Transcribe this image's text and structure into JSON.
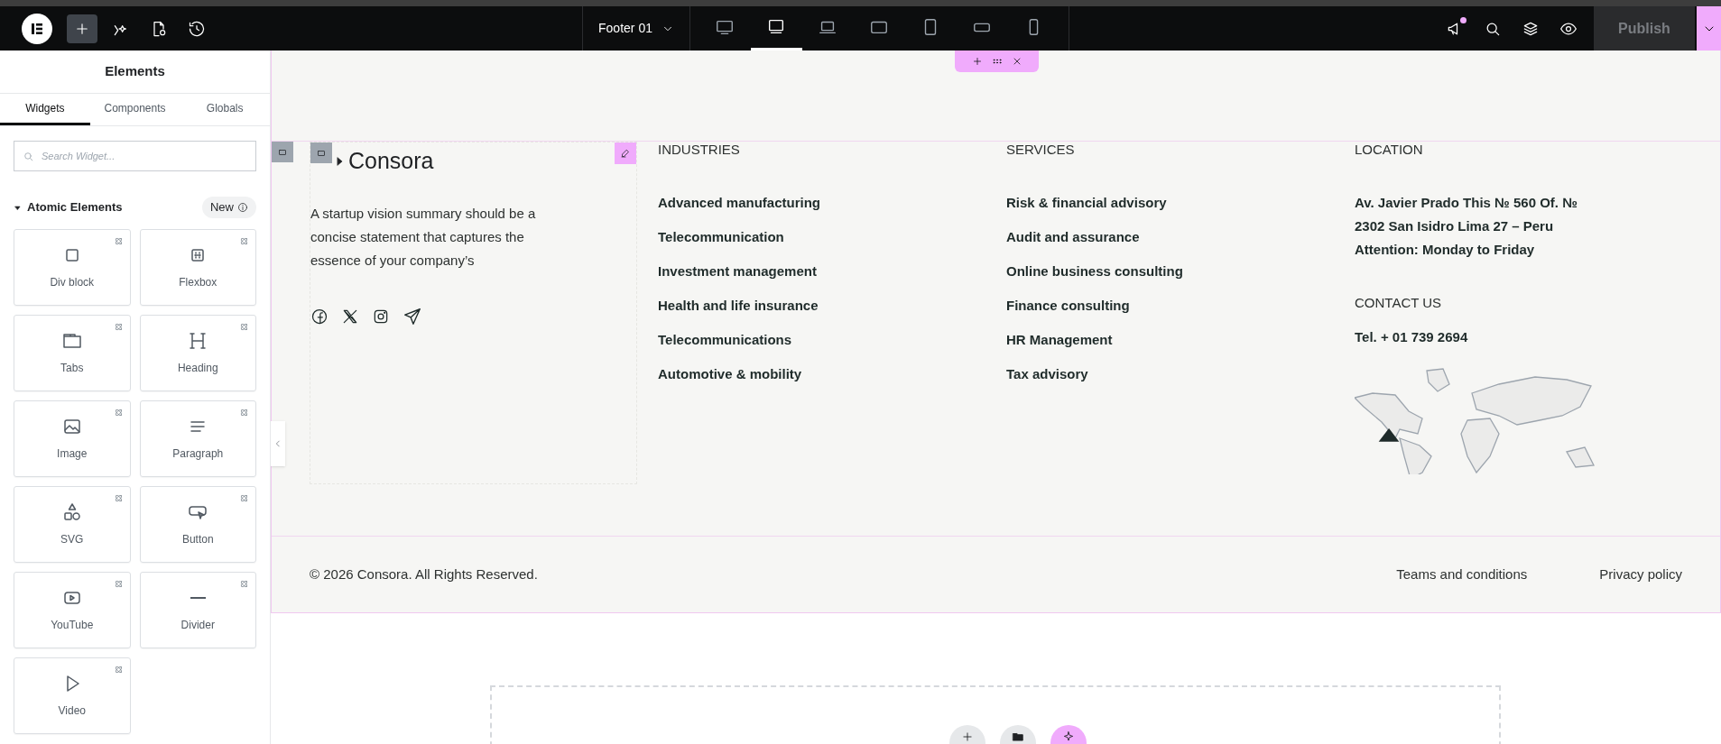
{
  "top_bar": {
    "document": "Footer 01",
    "devices": [
      {
        "kind": "desktop",
        "selected": false
      },
      {
        "kind": "widescreen",
        "selected": true
      },
      {
        "kind": "laptop",
        "selected": false
      },
      {
        "kind": "tablet-landscape",
        "selected": false
      },
      {
        "kind": "tablet",
        "selected": false
      },
      {
        "kind": "mobile-landscape",
        "selected": false
      },
      {
        "kind": "mobile",
        "selected": false
      }
    ],
    "notification": true,
    "publish": "Publish"
  },
  "panel": {
    "title": "Elements",
    "tabs": [
      {
        "label": "Widgets",
        "selected": true
      },
      {
        "label": "Components",
        "selected": false
      },
      {
        "label": "Globals",
        "selected": false
      }
    ],
    "search": {
      "placeholder": "Search Widget..."
    },
    "section": {
      "title": "Atomic Elements",
      "expanded": true,
      "badge": "New"
    },
    "widgets": [
      {
        "label": "Div block",
        "kind": "div"
      },
      {
        "label": "Flexbox",
        "kind": "flexbox"
      },
      {
        "label": "Tabs",
        "kind": "tabs"
      },
      {
        "label": "Heading",
        "kind": "heading"
      },
      {
        "label": "Image",
        "kind": "image"
      },
      {
        "label": "Paragraph",
        "kind": "paragraph"
      },
      {
        "label": "SVG",
        "kind": "svg"
      },
      {
        "label": "Button",
        "kind": "button"
      },
      {
        "label": "YouTube",
        "kind": "youtube"
      },
      {
        "label": "Divider",
        "kind": "divider"
      },
      {
        "label": "Video",
        "kind": "video"
      }
    ]
  },
  "footer": {
    "brand": "Consora",
    "description": "A startup vision summary should be a concise statement that captures the essence of your company’s",
    "columns": [
      {
        "heading": "INDUSTRIES",
        "items": [
          "Advanced manufacturing",
          "Telecommunication",
          "Investment management",
          "Health and life insurance",
          "Telecommunications",
          "Automotive & mobility"
        ]
      },
      {
        "heading": "SERVICES",
        "items": [
          "Risk & financial advisory",
          "Audit and assurance",
          "Online business consulting",
          "Finance consulting",
          "HR Management",
          "Tax advisory"
        ]
      }
    ],
    "location": {
      "heading": "LOCATION",
      "lines": [
        "Av. Javier Prado This № 560 Of. №",
        "2302 San Isidro Lima 27 – Peru",
        "Attention: Monday to Friday"
      ]
    },
    "contact": {
      "heading": "CONTACT US",
      "phone": "Tel. + 01 739 2694"
    },
    "copyright": "© 2026 Consora. All Rights Reserved.",
    "links": [
      "Teams and conditions",
      "Privacy policy"
    ]
  }
}
